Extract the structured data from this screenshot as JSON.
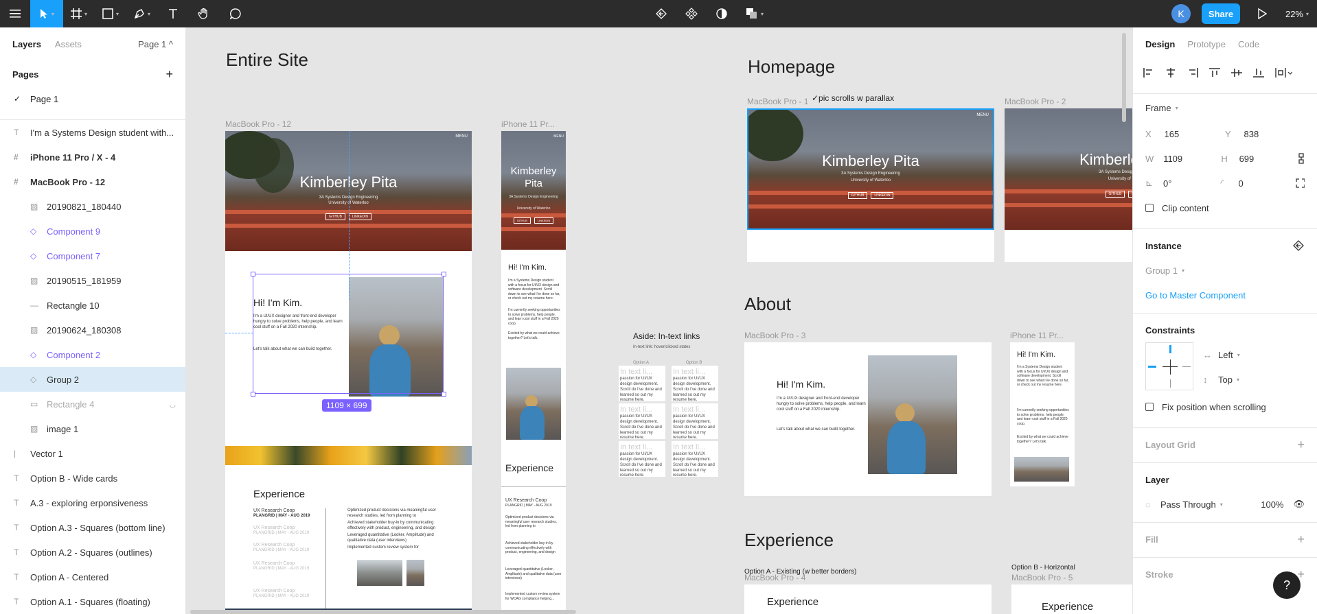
{
  "toolbar": {
    "avatar_letter": "K",
    "share_label": "Share",
    "zoom": "22%"
  },
  "left_panel": {
    "tabs": [
      "Layers",
      "Assets"
    ],
    "page_selector": "Page 1 ^",
    "pages_heading": "Pages",
    "pages": [
      {
        "label": "Page 1",
        "checked": "✓"
      }
    ],
    "layers": [
      {
        "label": "I'm a Systems Design student with...",
        "icon": "text-icon",
        "glyph": "T"
      },
      {
        "label": "iPhone 11 Pro / X - 4",
        "icon": "frame-icon",
        "glyph": "#"
      },
      {
        "label": "MacBook Pro - 12",
        "icon": "frame-icon",
        "glyph": "#"
      },
      {
        "label": "20190821_180440",
        "icon": "image-icon",
        "glyph": "▨"
      },
      {
        "label": "Component 9",
        "icon": "component-instance-icon",
        "glyph": "◇"
      },
      {
        "label": "Component 7",
        "icon": "component-instance-icon",
        "glyph": "◇"
      },
      {
        "label": "20190515_181959",
        "icon": "image-icon",
        "glyph": "▨"
      },
      {
        "label": "Rectangle 10",
        "icon": "line-icon",
        "glyph": "—"
      },
      {
        "label": "20190624_180308",
        "icon": "image-icon",
        "glyph": "▨"
      },
      {
        "label": "Component 2",
        "icon": "component-instance-icon",
        "glyph": "◇"
      },
      {
        "label": "Group 2",
        "icon": "component-instance-icon",
        "glyph": "◇"
      },
      {
        "label": "Rectangle 4",
        "icon": "rectangle-icon",
        "glyph": "▭"
      },
      {
        "label": "image 1",
        "icon": "image-icon",
        "glyph": "▨"
      },
      {
        "label": "Vector 1",
        "icon": "vector-icon",
        "glyph": "|"
      },
      {
        "label": "Option B - Wide cards",
        "icon": "text-icon",
        "glyph": "T"
      },
      {
        "label": "A.3 - exploring erponsiveness",
        "icon": "text-icon",
        "glyph": "T"
      },
      {
        "label": "Option A.3 - Squares (bottom line)",
        "icon": "text-icon",
        "glyph": "T"
      },
      {
        "label": "Option A.2 - Squares (outlines)",
        "icon": "text-icon",
        "glyph": "T"
      },
      {
        "label": "Option A - Centered",
        "icon": "text-icon",
        "glyph": "T"
      },
      {
        "label": "Option A.1 - Squares (floating)",
        "icon": "text-icon",
        "glyph": "T"
      }
    ]
  },
  "canvas": {
    "section_entire": "Entire Site",
    "section_homepage": "Homepage",
    "section_about": "About",
    "section_experience": "Experience",
    "label_mbp12": "MacBook Pro - 12",
    "label_iphone": "iPhone 11 Pr...",
    "label_mbp1": "MacBook Pro - 1",
    "label_mbp2": "MacBook Pro - 2",
    "label_mbp3": "MacBook Pro - 3",
    "label_iphone2": "iPhone 11 Pr...",
    "label_mbp4": "MacBook Pro - 4",
    "label_mbp5": "MacBook Pro - 5",
    "note_parallax": "✓pic scrolls w parallax",
    "aside_title": "Aside: In-text links",
    "aside_sub": "In-text link: hover/clicked states",
    "aside_optA": "Option A",
    "aside_optB": "Option B",
    "aside_card_head": "In text li...",
    "aside_card_body": "passion for UI/UX design development. Scroll do I've done and learned so out my resume here.",
    "option_a_existing": "Option A - Existing (w better borders)",
    "option_b_horizontal": "Option B - Horizontal",
    "hero_name": "Kimberley Pita",
    "hero_sub1": "3A Systems Design Engineering",
    "hero_sub2": "University of Waterloo",
    "hero_btn1": "GITHUB",
    "hero_btn2": "LINKEDIN",
    "menu": "MENU",
    "hi_title": "Hi! I'm Kim.",
    "hi_body": "I'm a UI/UX designer and front-end developer hungry to solve problems, help people, and learn cool stuff on a Fall 2020 internship.",
    "hi_link": "Let's talk about what we can build together.",
    "iphone_hi_body": "I'm a Systems Design student with a focus for UI/UX design and software development. Scroll down to see what I've done so far, or check out my resume here.",
    "iphone_seek": "I'm currently seeking opportunities to solve problems, help people, and learn cool stuff in a Fall 2020 coop.",
    "iphone_excited": "Excited by what we could achieve together? Let's talk.",
    "dim_badge": "1109 × 699",
    "exp_title": "Experience",
    "exp_job": "UX Research Coop",
    "exp_company": "PLANGRID | MAY - AUG 2019",
    "exp_desc1": "Optimized product decisions via meaningful user research studies, led from planning to",
    "exp_desc2": "Achieved stakeholder buy-in by communicating effectively with product, engineering, and design",
    "exp_desc3": "Leveraged quantitative (Looker, Amplitude) and qualitative data (user interviews)",
    "exp_desc4": "Implemented custom review system for",
    "iphone_exp_desc": "Optimized product decisions via meaningful user research studies, led from planning to",
    "iphone_exp_desc2": "Achieved stakeholder buy-in by communicating effectively with product, engineering, and design",
    "iphone_exp_desc3": "Leveraged quantitative (Looker, Amplitude) and qualitative data (user interviews)",
    "iphone_exp_desc4": "Implemented custom review system for WCAG compliance helping..."
  },
  "right_panel": {
    "tabs": [
      "Design",
      "Prototype",
      "Code"
    ],
    "frame_label": "Frame",
    "x_label": "X",
    "x": "165",
    "y_label": "Y",
    "y": "838",
    "w_label": "W",
    "w": "1109",
    "h_label": "H",
    "h": "699",
    "rotation": "0°",
    "radius": "0",
    "clip_content": "Clip content",
    "instance_heading": "Instance",
    "instance_group": "Group 1",
    "go_to_master": "Go to Master Component",
    "constraints_heading": "Constraints",
    "constraint_h": "Left",
    "constraint_v": "Top",
    "fix_position": "Fix position when scrolling",
    "layout_grid": "Layout Grid",
    "layer_heading": "Layer",
    "blend_mode": "Pass Through",
    "opacity": "100%",
    "fill_heading": "Fill",
    "stroke_heading": "Stroke",
    "help": "?"
  },
  "colors": {
    "toolbar_bg": "#2c2c2c",
    "accent": "#18a0fb",
    "selection_purple": "#7b61ff",
    "canvas_bg": "#e5e5e5",
    "avatar": "#4a90e2"
  }
}
